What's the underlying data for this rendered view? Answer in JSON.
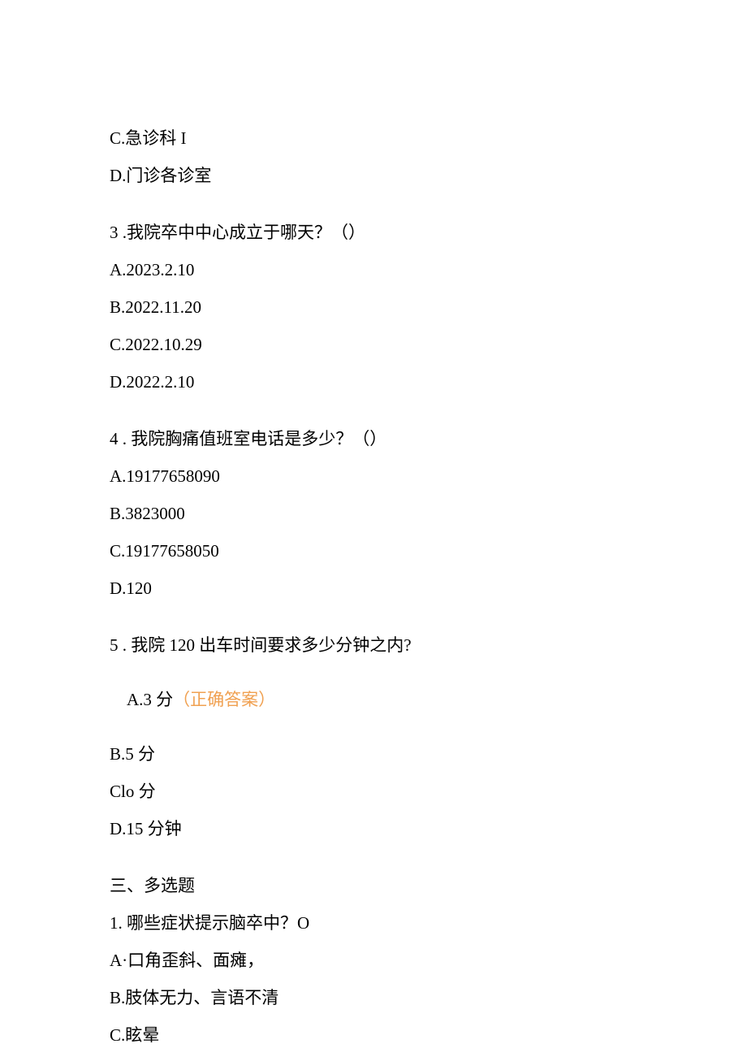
{
  "q2": {
    "c": "C.急诊科 I",
    "d": "D.门诊各诊室"
  },
  "q3": {
    "stem": "3 .我院卒中中心成立于哪天？（）",
    "a": "A.2023.2.10",
    "b": "B.2022.11.20",
    "c": "C.2022.10.29",
    "d": "D.2022.2.10"
  },
  "q4": {
    "stem": "4 . 我院胸痛值班室电话是多少？（）",
    "a": "A.19177658090",
    "b": "B.3823000",
    "c": "C.19177658050",
    "d": "D.120"
  },
  "q5": {
    "stem": "5 . 我院 120 出车时间要求多少分钟之内?",
    "a_prefix": "A.3 分",
    "a_correct": "（正确答案）",
    "b": "B.5 分",
    "c": "Clo 分",
    "d": "D.15 分钟"
  },
  "section3": {
    "heading": "三、多选题",
    "q1": {
      "stem": "1. 哪些症状提示脑卒中？O",
      "a": "A·口角歪斜、面瘫，",
      "b": "B.肢体无力、言语不清",
      "c": "C.眩晕"
    }
  }
}
